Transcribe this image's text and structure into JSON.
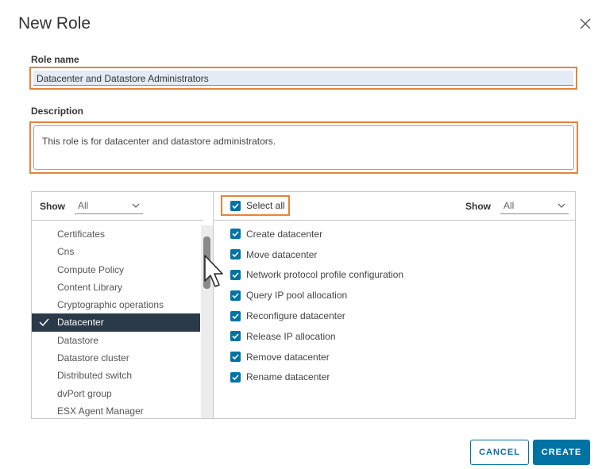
{
  "dialog": {
    "title": "New Role",
    "close_icon": "close-icon"
  },
  "role_name": {
    "label": "Role name",
    "value": "Datacenter and Datastore Administrators"
  },
  "description": {
    "label": "Description",
    "value": "This role is for datacenter and datastore administrators."
  },
  "categories": {
    "show_label": "Show",
    "filter_value": "All",
    "items": [
      {
        "label": "Certificates"
      },
      {
        "label": "Cns"
      },
      {
        "label": "Compute Policy"
      },
      {
        "label": "Content Library"
      },
      {
        "label": "Cryptographic operations"
      },
      {
        "label": "Datacenter"
      },
      {
        "label": "Datastore"
      },
      {
        "label": "Datastore cluster"
      },
      {
        "label": "Distributed switch"
      },
      {
        "label": "dvPort group"
      },
      {
        "label": "ESX Agent Manager"
      }
    ],
    "selected": "Datacenter"
  },
  "privileges": {
    "select_all_label": "Select all",
    "show_label": "Show",
    "filter_value": "All",
    "items": [
      {
        "label": "Create datacenter"
      },
      {
        "label": "Move datacenter"
      },
      {
        "label": "Network protocol profile configuration"
      },
      {
        "label": "Query IP pool allocation"
      },
      {
        "label": "Reconfigure datacenter"
      },
      {
        "label": "Release IP allocation"
      },
      {
        "label": "Remove datacenter"
      },
      {
        "label": "Rename datacenter"
      }
    ]
  },
  "footer": {
    "cancel_label": "CANCEL",
    "create_label": "CREATE"
  },
  "colors": {
    "accent": "#0072a3",
    "highlight_border": "#e8833a",
    "selected_row": "#2b3a48"
  }
}
